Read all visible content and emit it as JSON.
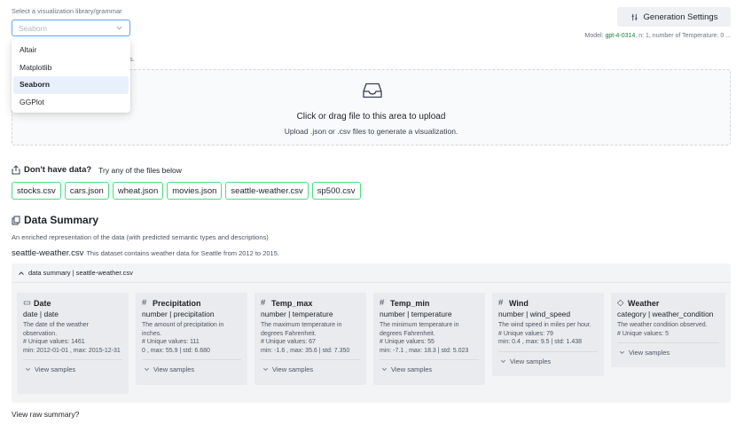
{
  "library": {
    "label": "Select a visualization library/grammar",
    "selected": "Seaborn",
    "options": [
      "Altair",
      "Matplotlib",
      "Seaborn",
      "GGPlot"
    ],
    "hidden_hint": "s."
  },
  "generation": {
    "button_label": "Generation Settings",
    "model_prefix": "Model: ",
    "model_value": "gpt-4-0314",
    "model_suffix": ", n: 1, number of Temperature: 0 ..."
  },
  "upload": {
    "title": "Click or drag file to this area to upload",
    "subtitle": "Upload .json or .csv files to generate a visualization."
  },
  "no_data": {
    "title": "Don't have data?",
    "subtitle": "Try any of the files below",
    "files": [
      "stocks.csv",
      "cars.json",
      "wheat.json",
      "movies.json",
      "seattle-weather.csv",
      "sp500.csv"
    ]
  },
  "summary": {
    "title": "Data Summary",
    "description": "An enriched representation of the data (with predicted semantic types and descriptions)",
    "file_name": "seattle-weather.csv",
    "file_description": "This dataset contains weather data for Seattle from 2012 to 2015.",
    "accordion_label": "data summary | seattle-weather.csv",
    "view_samples": "View samples",
    "fields": [
      {
        "icon": "calendar-icon",
        "glyph": "▭",
        "name": "Date",
        "type": "date | date",
        "description": "The date of the weather observation.",
        "stats": [
          "# Unique values: 1461",
          "min: 2012-01-01 , max: 2015-12-31"
        ]
      },
      {
        "icon": "hash-icon",
        "glyph": "#",
        "name": "Precipitation",
        "type": "number | precipitation",
        "description": "The amount of precipitation in inches.",
        "stats": [
          "# Unique values: 111",
          "0 , max: 55.9 | std: 6.680"
        ]
      },
      {
        "icon": "hash-icon",
        "glyph": "#",
        "name": "Temp_max",
        "type": "number | temperature",
        "description": "The maximum temperature in degrees Fahrenheit.",
        "stats": [
          "# Unique values: 67",
          "min: -1.6 , max: 35.6 | std: 7.350"
        ]
      },
      {
        "icon": "hash-icon",
        "glyph": "#",
        "name": "Temp_min",
        "type": "number | temperature",
        "description": "The minimum temperature in degrees Fahrenheit.",
        "stats": [
          "# Unique values: 55",
          "min: -7.1 , max: 18.3 | std: 5.023"
        ]
      },
      {
        "icon": "hash-icon",
        "glyph": "#",
        "name": "Wind",
        "type": "number | wind_speed",
        "description": "The wind speed in miles per hour.",
        "stats": [
          "# Unique values: 79",
          "min: 0.4 , max: 9.5 | std: 1.438"
        ]
      },
      {
        "icon": "tag-icon",
        "glyph": "◇",
        "name": "Weather",
        "type": "category | weather_condition",
        "description": "The weather condition observed.",
        "stats": [
          "# Unique values: 5"
        ]
      }
    ]
  },
  "raw_summary_link": "View raw summary?",
  "colors": {
    "accent_border": "#60a5fa",
    "file_border": "#4ade80",
    "model_value": "#15803d"
  }
}
